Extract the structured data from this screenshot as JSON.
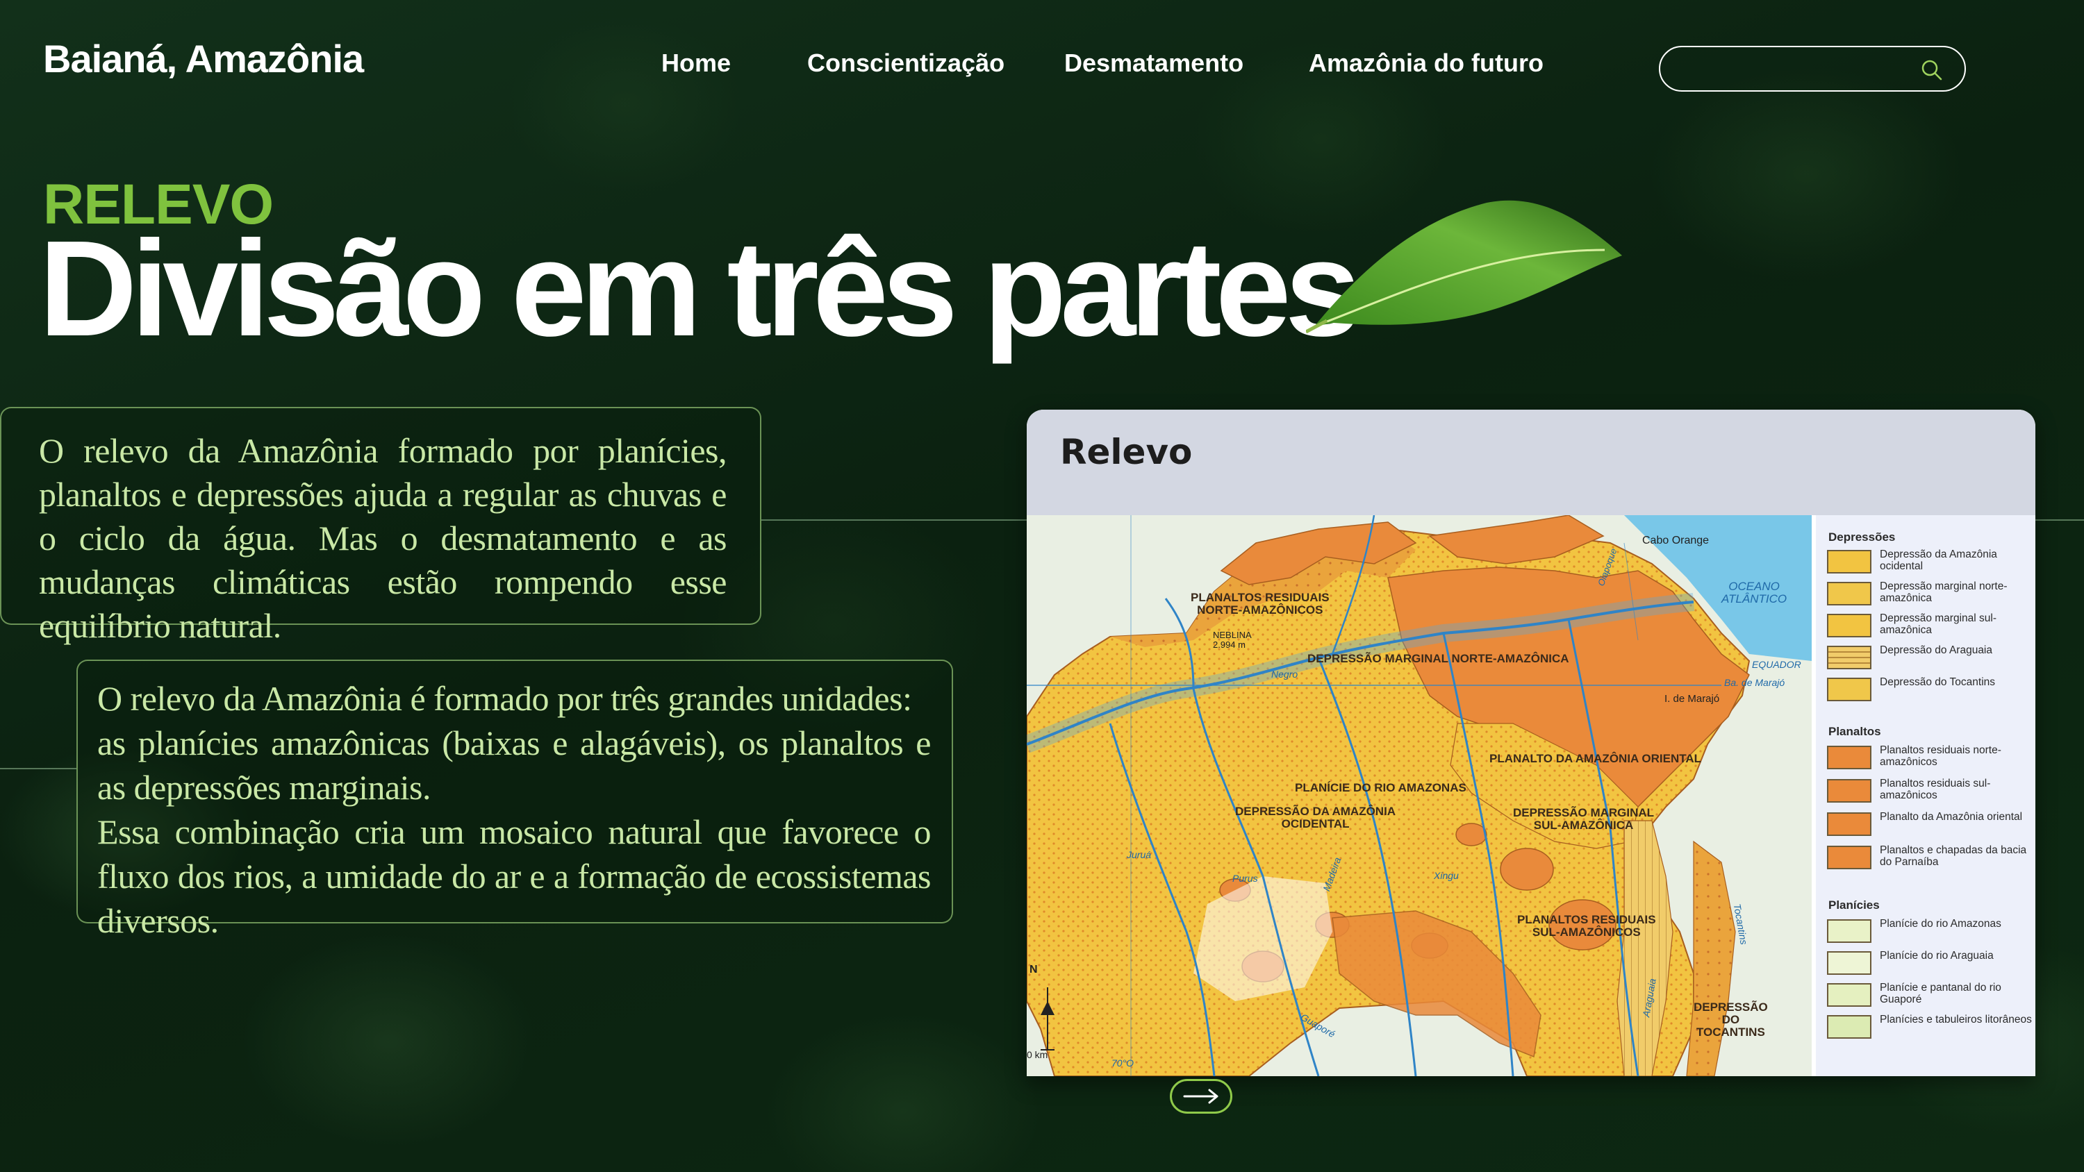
{
  "brand": "Baianá, Amazônia",
  "nav": [
    "Home",
    "Conscientização",
    "Desmatamento",
    "Amazônia do futuro"
  ],
  "search": {
    "placeholder": "",
    "icon": "search-icon"
  },
  "kicker": "RELEVO",
  "headline": "Divisão em três partes",
  "paragraph1": "O relevo da Amazônia formado por planícies, planaltos e depressões  ajuda a regular as chuvas e o ciclo da água. Mas o desmatamento e as mudanças climáticas estão rompendo esse equilíbrio natural.",
  "paragraph2": "O relevo da Amazônia é formado por três grandes unidades:\n as planícies amazônicas (baixas e alagáveis), os planaltos e as depressões marginais.\n Essa combinação cria um mosaico natural que favorece o fluxo dos rios, a umidade do ar e a formação de ecossistemas diversos.",
  "map": {
    "title": "Relevo",
    "labels": {
      "planaltos_norte": "PLANALTOS RESIDUAIS\nNORTE-AMAZÔNICOS",
      "neblina": "NEBLINA\n2.994 m",
      "cabo_orange": "Cabo Orange",
      "oceano": "OCEANO\nATLÂNTICO",
      "equador": "EQUADOR",
      "marajo_ba": "Ba. de Marajó",
      "marajo_i": "I. de Marajó",
      "negro": "Negro",
      "dep_norte": "DEPRESSÃO MARGINAL NORTE-AMAZÔNICA",
      "planicie": "PLANÍCIE DO RIO AMAZONAS",
      "planalto_oriental": "PLANALTO DA AMAZÔNIA ORIENTAL",
      "dep_ocidental": "DEPRESSÃO DA AMAZÔNIA\nOCIDENTAL",
      "dep_sul": "DEPRESSÃO MARGINAL\nSUL-AMAZÔNICA",
      "planaltos_sul": "PLANALTOS RESIDUAIS\nSUL-AMAZÔNICOS",
      "dep_tocantins": "DEPRESSÃO\nDO\nTOCANTINS",
      "purus": "Purus",
      "madeira": "Madeira",
      "jurua": "Juruá",
      "guapore": "Guaporé",
      "xingu": "Xingu",
      "tocantins": "Tocantins",
      "araguaia": "Araguaia",
      "oiapoque": "Oiapoque",
      "scale": "0 km",
      "long": "70°O",
      "north": "N"
    },
    "legend": {
      "sections": [
        "Depressões",
        "Planaltos",
        "Planícies"
      ],
      "depressoes": [
        "Depressão da Amazônia ocidental",
        "Depressão marginal norte-amazônica",
        "Depressão marginal sul-amazônica",
        "Depressão do Araguaia",
        "Depressão do Tocantins"
      ],
      "planaltos": [
        "Planaltos residuais norte-amazônicos",
        "Planaltos residuais sul-amazônicos",
        "Planalto da Amazônia oriental",
        "Planaltos e chapadas da bacia do Parnaíba"
      ],
      "planicies": [
        "Planície do rio Amazonas",
        "Planície do rio Araguaia",
        "Planície e pantanal do rio Guaporé",
        "Planícies e tabuleiros litorâneos"
      ]
    }
  },
  "colors": {
    "accent": "#7fc23e",
    "depression": "#f2c441",
    "plateau": "#ea8a3a",
    "plain": "#e9f2c8",
    "water": "#79c7e8"
  },
  "next_button": {
    "icon": "arrow-right-icon"
  }
}
